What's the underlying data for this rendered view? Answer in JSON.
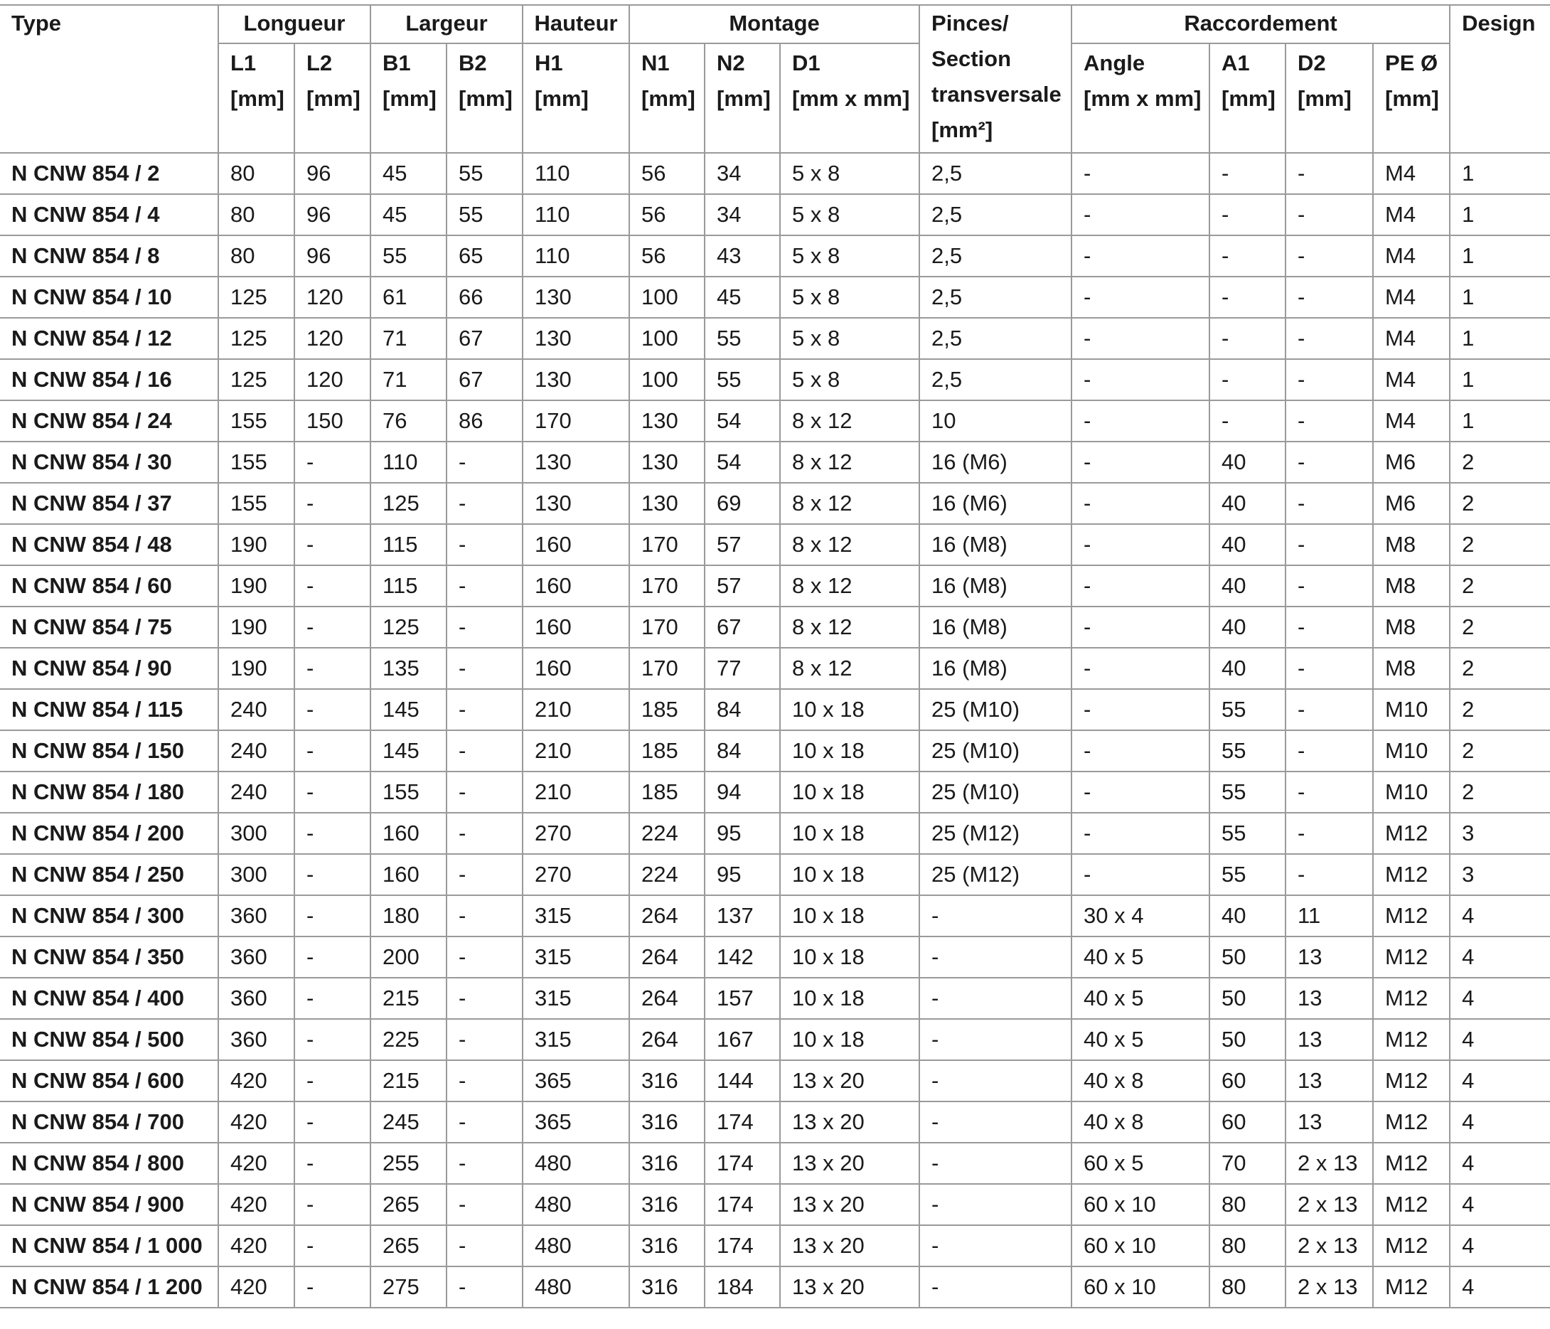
{
  "table": {
    "group_headers": {
      "type": "Type",
      "longueur": "Longueur",
      "largeur": "Largeur",
      "hauteur": "Hauteur",
      "montage": "Montage",
      "pinces_l1": "Pinces/",
      "pinces_l2": "Section",
      "pinces_l3": "transversale",
      "pinces_l4": "[mm²]",
      "raccordement": "Raccordement",
      "design": "Design"
    },
    "sub_headers": {
      "l1": [
        "L1",
        "[mm]"
      ],
      "l2": [
        "L2",
        "[mm]"
      ],
      "b1": [
        "B1",
        "[mm]"
      ],
      "b2": [
        "B2",
        "[mm]"
      ],
      "h1": [
        "H1",
        "[mm]"
      ],
      "n1": [
        "N1",
        "[mm]"
      ],
      "n2": [
        "N2",
        "[mm]"
      ],
      "d1": [
        "D1",
        "[mm x mm]"
      ],
      "angle": [
        "Angle",
        "[mm x mm]"
      ],
      "a1": [
        "A1",
        "[mm]"
      ],
      "d2": [
        "D2",
        "[mm]"
      ],
      "pe": [
        "PE Ø",
        "[mm]"
      ]
    },
    "rows": [
      [
        "N CNW 854 / 2",
        "80",
        "96",
        "45",
        "55",
        "110",
        "56",
        "34",
        "5 x 8",
        "2,5",
        "-",
        "-",
        "-",
        "M4",
        "1"
      ],
      [
        "N CNW 854 / 4",
        "80",
        "96",
        "45",
        "55",
        "110",
        "56",
        "34",
        "5 x 8",
        "2,5",
        "-",
        "-",
        "-",
        "M4",
        "1"
      ],
      [
        "N CNW 854 / 8",
        "80",
        "96",
        "55",
        "65",
        "110",
        "56",
        "43",
        "5 x 8",
        "2,5",
        "-",
        "-",
        "-",
        "M4",
        "1"
      ],
      [
        "N CNW 854 / 10",
        "125",
        "120",
        "61",
        "66",
        "130",
        "100",
        "45",
        "5 x 8",
        "2,5",
        "-",
        "-",
        "-",
        "M4",
        "1"
      ],
      [
        "N CNW 854 / 12",
        "125",
        "120",
        "71",
        "67",
        "130",
        "100",
        "55",
        "5 x 8",
        "2,5",
        "-",
        "-",
        "-",
        "M4",
        "1"
      ],
      [
        "N CNW 854 / 16",
        "125",
        "120",
        "71",
        "67",
        "130",
        "100",
        "55",
        "5 x 8",
        "2,5",
        "-",
        "-",
        "-",
        "M4",
        "1"
      ],
      [
        "N CNW 854 / 24",
        "155",
        "150",
        "76",
        "86",
        "170",
        "130",
        "54",
        "8 x 12",
        "10",
        "-",
        "-",
        "-",
        "M4",
        "1"
      ],
      [
        "N CNW 854 / 30",
        "155",
        "-",
        "110",
        "-",
        "130",
        "130",
        "54",
        "8 x 12",
        "16 (M6)",
        "-",
        "40",
        "-",
        "M6",
        "2"
      ],
      [
        "N CNW 854 / 37",
        "155",
        "-",
        "125",
        "-",
        "130",
        "130",
        "69",
        "8 x 12",
        "16 (M6)",
        "-",
        "40",
        "-",
        "M6",
        "2"
      ],
      [
        "N CNW 854 / 48",
        "190",
        "-",
        "115",
        "-",
        "160",
        "170",
        "57",
        "8 x 12",
        "16 (M8)",
        "-",
        "40",
        "-",
        "M8",
        "2"
      ],
      [
        "N CNW 854 / 60",
        "190",
        "-",
        "115",
        "-",
        "160",
        "170",
        "57",
        "8 x 12",
        "16 (M8)",
        "-",
        "40",
        "-",
        "M8",
        "2"
      ],
      [
        "N CNW 854 / 75",
        "190",
        "-",
        "125",
        "-",
        "160",
        "170",
        "67",
        "8 x 12",
        "16 (M8)",
        "-",
        "40",
        "-",
        "M8",
        "2"
      ],
      [
        "N CNW 854 / 90",
        "190",
        "-",
        "135",
        "-",
        "160",
        "170",
        "77",
        "8 x 12",
        "16 (M8)",
        "-",
        "40",
        "-",
        "M8",
        "2"
      ],
      [
        "N CNW 854 / 115",
        "240",
        "-",
        "145",
        "-",
        "210",
        "185",
        "84",
        "10 x 18",
        "25 (M10)",
        "-",
        "55",
        "-",
        "M10",
        "2"
      ],
      [
        "N CNW 854 / 150",
        "240",
        "-",
        "145",
        "-",
        "210",
        "185",
        "84",
        "10 x 18",
        "25 (M10)",
        "-",
        "55",
        "-",
        "M10",
        "2"
      ],
      [
        "N CNW 854 / 180",
        "240",
        "-",
        "155",
        "-",
        "210",
        "185",
        "94",
        "10 x 18",
        "25 (M10)",
        "-",
        "55",
        "-",
        "M10",
        "2"
      ],
      [
        "N CNW 854 / 200",
        "300",
        "-",
        "160",
        "-",
        "270",
        "224",
        "95",
        "10 x 18",
        "25 (M12)",
        "-",
        "55",
        "-",
        "M12",
        "3"
      ],
      [
        "N CNW 854 / 250",
        "300",
        "-",
        "160",
        "-",
        "270",
        "224",
        "95",
        "10 x 18",
        "25 (M12)",
        "-",
        "55",
        "-",
        "M12",
        "3"
      ],
      [
        "N CNW 854 / 300",
        "360",
        "-",
        "180",
        "-",
        "315",
        "264",
        "137",
        "10 x 18",
        "-",
        "30 x 4",
        "40",
        "11",
        "M12",
        "4"
      ],
      [
        "N CNW 854 / 350",
        "360",
        "-",
        "200",
        "-",
        "315",
        "264",
        "142",
        "10 x 18",
        "-",
        "40 x 5",
        "50",
        "13",
        "M12",
        "4"
      ],
      [
        "N CNW 854 / 400",
        "360",
        "-",
        "215",
        "-",
        "315",
        "264",
        "157",
        "10 x 18",
        "-",
        "40 x 5",
        "50",
        "13",
        "M12",
        "4"
      ],
      [
        "N CNW 854 / 500",
        "360",
        "-",
        "225",
        "-",
        "315",
        "264",
        "167",
        "10 x 18",
        "-",
        "40 x 5",
        "50",
        "13",
        "M12",
        "4"
      ],
      [
        "N CNW 854 / 600",
        "420",
        "-",
        "215",
        "-",
        "365",
        "316",
        "144",
        "13 x 20",
        "-",
        "40 x 8",
        "60",
        "13",
        "M12",
        "4"
      ],
      [
        "N CNW 854 / 700",
        "420",
        "-",
        "245",
        "-",
        "365",
        "316",
        "174",
        "13 x 20",
        "-",
        "40 x 8",
        "60",
        "13",
        "M12",
        "4"
      ],
      [
        "N CNW 854 / 800",
        "420",
        "-",
        "255",
        "-",
        "480",
        "316",
        "174",
        "13 x 20",
        "-",
        "60 x 5",
        "70",
        "2 x 13",
        "M12",
        "4"
      ],
      [
        "N  CNW 854 / 900",
        "420",
        "-",
        "265",
        "-",
        "480",
        "316",
        "174",
        "13 x 20",
        "-",
        "60 x 10",
        "80",
        "2 x 13",
        "M12",
        "4"
      ],
      [
        "N CNW 854 / 1 000",
        "420",
        "-",
        "265",
        "-",
        "480",
        "316",
        "174",
        "13 x 20",
        "-",
        "60 x 10",
        "80",
        "2 x 13",
        "M12",
        "4"
      ],
      [
        "N CNW 854 / 1 200",
        "420",
        "-",
        "275",
        "-",
        "480",
        "316",
        "184",
        "13 x 20",
        "-",
        "60 x 10",
        "80",
        "2 x 13",
        "M12",
        "4"
      ]
    ]
  }
}
